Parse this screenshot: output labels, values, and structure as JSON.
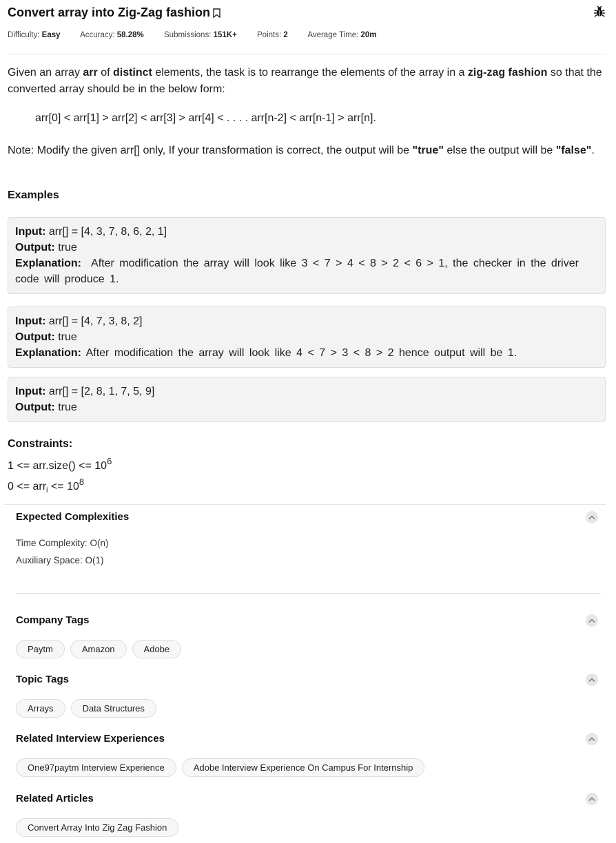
{
  "problem": {
    "title": "Convert array into Zig-Zag fashion",
    "meta": {
      "difficulty_label": "Difficulty:",
      "difficulty": "Easy",
      "accuracy_label": "Accuracy:",
      "accuracy": "58.28%",
      "submissions_label": "Submissions:",
      "submissions": "151K+",
      "points_label": "Points:",
      "points": "2",
      "time_label": "Average Time:",
      "time": "20m"
    },
    "description": {
      "p1": "Given an array ",
      "b1": "arr",
      "p2": " of ",
      "b2": "distinct",
      "p3": " elements, the task is to rearrange the elements of the array in a ",
      "b3": "zig-zag fashion",
      "p4": " so that the converted array should be in the below form:"
    },
    "formula": "arr[0] < arr[1]  > arr[2] < arr[3] > arr[4] < . . . . arr[n-2] < arr[n-1] > arr[n].",
    "note": {
      "p1": "Note: Modify the given arr[] only, If your transformation is correct, the output will be ",
      "b1": "\"true\"",
      "p2": " else the output will be ",
      "b2": "\"false\"",
      "p3": "."
    },
    "examples_heading": "Examples",
    "input_label": "Input:",
    "output_label": "Output:",
    "explanation_label": "Explanation:",
    "examples": [
      {
        "input": "arr[] = [4, 3, 7, 8, 6, 2, 1]",
        "output": "true",
        "explanation": "After modification the array will look like 3 < 7 > 4 < 8 > 2 < 6 > 1, the checker in the driver code will produce 1."
      },
      {
        "input": "arr[] = [4, 7, 3, 8, 2]",
        "output": "true",
        "explanation": "After modification the array will look like 4 < 7 > 3 < 8 > 2 hence output will be 1."
      },
      {
        "input": "arr[] = [2, 8, 1, 7, 5, 9]",
        "output": "true"
      }
    ],
    "constraints_heading": "Constraints:",
    "constraints": {
      "c1_text": "1 <= arr.size() <= 10",
      "c1_exp": "6",
      "c2_pre": "0 <= arr",
      "c2_sub": "i",
      "c2_post": " <= 10",
      "c2_exp": "8"
    }
  },
  "panel": {
    "complexities_heading": "Expected Complexities",
    "time_complexity": "Time Complexity: O(n)",
    "aux_space": "Auxiliary Space: O(1)",
    "company_heading": "Company Tags",
    "company_tags": [
      "Paytm",
      "Amazon",
      "Adobe"
    ],
    "topic_heading": "Topic Tags",
    "topic_tags": [
      "Arrays",
      "Data Structures"
    ],
    "interview_heading": "Related Interview Experiences",
    "interview_tags": [
      "One97paytm Interview Experience",
      "Adobe Interview Experience On Campus For Internship"
    ],
    "articles_heading": "Related Articles",
    "article_tags": [
      "Convert Array Into Zig Zag Fashion"
    ]
  },
  "icons": {
    "bookmark": "bookmark-icon",
    "bug": "bug-icon",
    "chevron": "chevron-up-icon"
  }
}
